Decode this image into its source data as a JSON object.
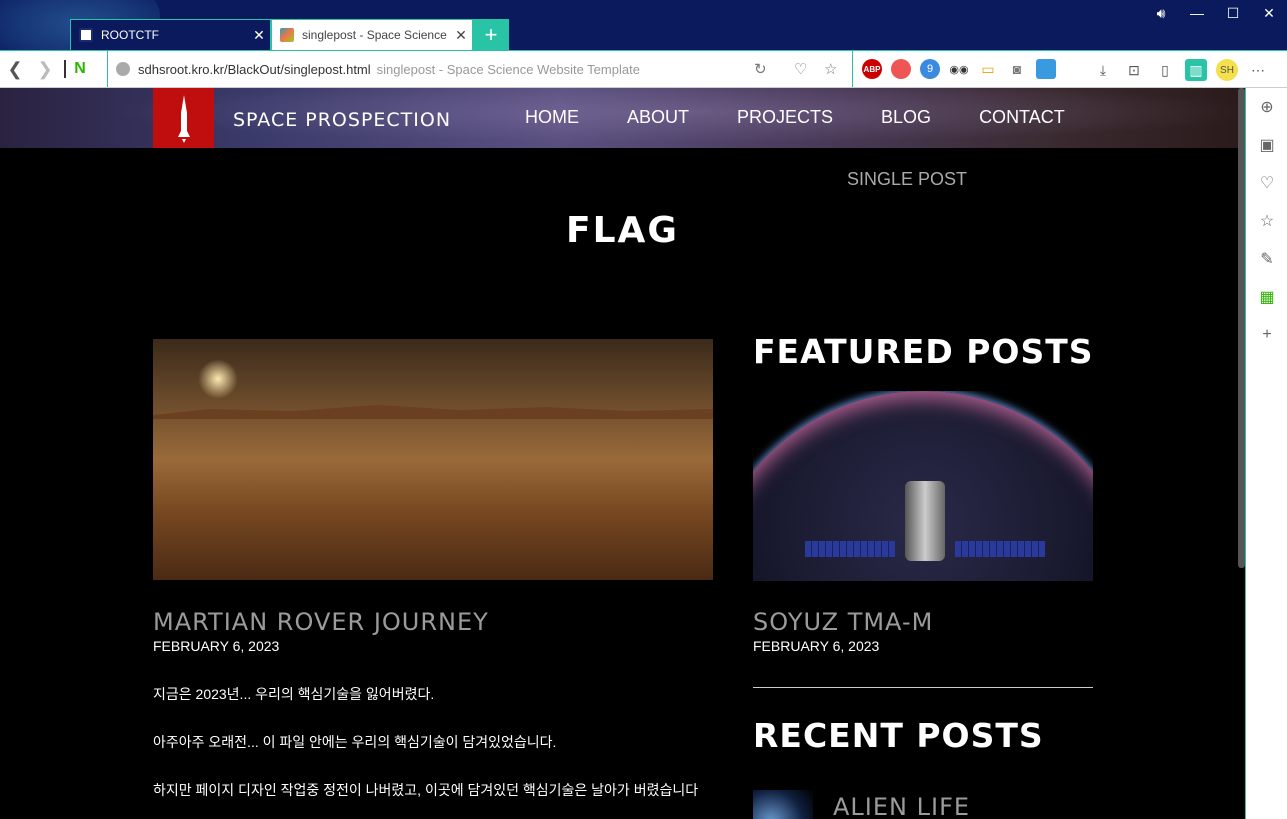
{
  "browser": {
    "tabs": [
      {
        "title": "ROOTCTF"
      },
      {
        "title": "singlepost - Space Science"
      }
    ],
    "url": "sdhsroot.kro.kr/BlackOut/singlepost.html",
    "page_title": "singlepost - Space Science Website Template",
    "naver_label": "N",
    "ext_badge": "9",
    "profile_initials": "SH"
  },
  "site": {
    "brand": "SPACE PROSPECTION",
    "menu": [
      "HOME",
      "ABOUT",
      "PROJECTS",
      "BLOG",
      "CONTACT"
    ],
    "breadcrumb": "SINGLE POST",
    "page_heading": "FLAG"
  },
  "post": {
    "title": "MARTIAN ROVER JOURNEY",
    "date": "FEBRUARY 6, 2023",
    "paragraphs": [
      "지금은 2023년... 우리의 핵심기술을 잃어버렸다.",
      "아주아주 오래전... 이 파일 안에는 우리의 핵심기술이 담겨있었습니다.",
      "하지만 페이지 디자인 작업중 정전이 나버렸고, 이곳에 담겨있던 핵심기술은 날아가 버렸습니다"
    ]
  },
  "sidebar": {
    "featured_heading": "FEATURED POSTS",
    "featured_title": "SOYUZ TMA-M",
    "featured_date": "FEBRUARY 6, 2023",
    "recent_heading": "RECENT POSTS",
    "recent_title": "ALIEN LIFE"
  },
  "colors": {
    "accent": "#29c4a6",
    "logo_red": "#c00d0d",
    "titlebar": "#0a1a5c"
  }
}
